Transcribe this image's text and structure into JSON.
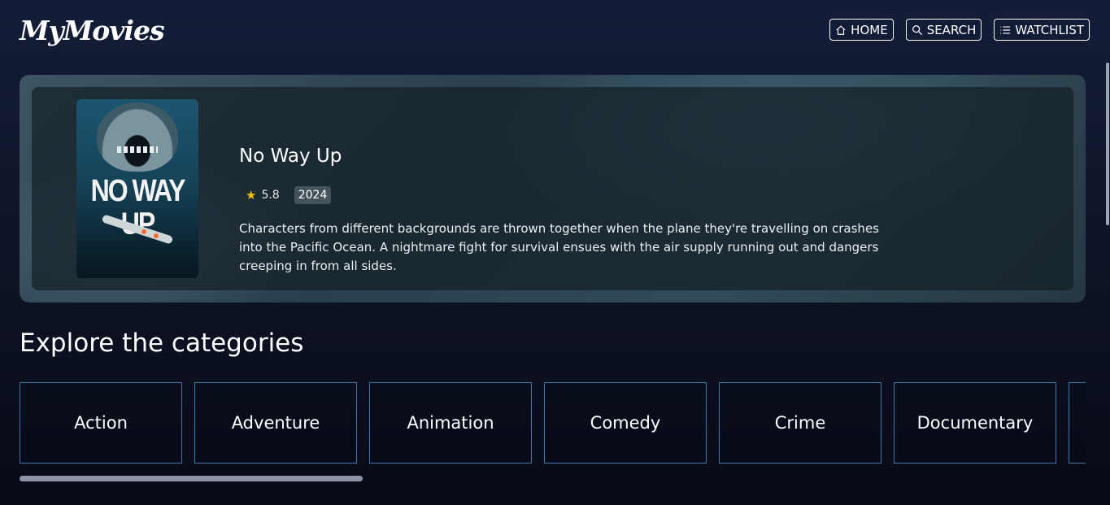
{
  "app": {
    "logo": "MyMovies"
  },
  "nav": [
    {
      "label": "HOME",
      "icon": "home-icon"
    },
    {
      "label": "SEARCH",
      "icon": "search-icon"
    },
    {
      "label": "WATCHLIST",
      "icon": "list-icon"
    }
  ],
  "featured": {
    "poster_text": "NO WAY UP",
    "title": "No Way Up",
    "rating": "5.8",
    "year": "2024",
    "overview": "Characters from different backgrounds are thrown together when the plane they're travelling on crashes into the Pacific Ocean. A nightmare fight for survival ensues with the air supply running out and dangers creeping in from all sides."
  },
  "categories_section": {
    "title": "Explore the categories",
    "items": [
      "Action",
      "Adventure",
      "Animation",
      "Comedy",
      "Crime",
      "Documentary",
      ""
    ]
  },
  "colors": {
    "accent_border": "#3f7aa6",
    "star": "#ffc107",
    "background": "#0e1428"
  }
}
